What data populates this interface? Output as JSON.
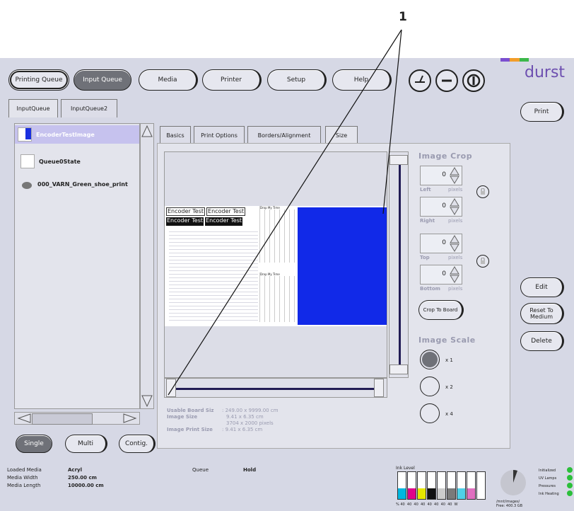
{
  "callout": {
    "number": "1"
  },
  "nav": {
    "printing_queue": "Printing Queue",
    "input_queue": "Input Queue",
    "media": "Media",
    "printer": "Printer",
    "setup": "Setup",
    "help": "Help"
  },
  "brand": {
    "name": "durst",
    "colors": [
      "#7b4fd0",
      "#f29d2a",
      "#3cb84a"
    ]
  },
  "queue_tabs": [
    "InputQueue",
    "InputQueue2"
  ],
  "queue_items": [
    {
      "name": "EncoderTestImage",
      "selected": true
    },
    {
      "name": "Queue0State",
      "selected": false
    },
    {
      "name": "000_VARN_Green_shoe_print",
      "selected": false
    }
  ],
  "queue_modes": {
    "single": "Single",
    "multi": "Multi",
    "contig": "Contig."
  },
  "detail_tabs": [
    "Basics",
    "Print Options",
    "Borders/Alignment",
    "Size"
  ],
  "preview": {
    "encoder_text": "Encoder Test",
    "chart_caption": "Drop My Time"
  },
  "image_crop": {
    "title": "Image Crop",
    "left": {
      "value": "0",
      "label": "Left",
      "unit": "pixels"
    },
    "right": {
      "value": "0",
      "label": "Right",
      "unit": "pixels"
    },
    "top": {
      "value": "0",
      "label": "Top",
      "unit": "pixels"
    },
    "bottom": {
      "value": "0",
      "label": "Bottom",
      "unit": "pixels"
    },
    "crop_button": "Crop To Board"
  },
  "image_scale": {
    "title": "Image Scale",
    "options": [
      "x 1",
      "x 2",
      "x 4"
    ],
    "selected": "x 1"
  },
  "info": {
    "usable_board_label": "Usable Board Siz",
    "usable_board_value": ": 249.00 x 9999.00 cm",
    "image_size_label": "Image Size",
    "image_size_value": "9.41 x 6.35 cm",
    "image_size_pixels": "3704 x 2000 pixels",
    "print_size_label": "Image Print Size",
    "print_size_value": ": 9.41 x 6.35 cm"
  },
  "right_buttons": {
    "print": "Print",
    "edit": "Edit",
    "reset": "Reset To Medium",
    "delete": "Delete"
  },
  "footer": {
    "loaded_media_label": "Loaded Media",
    "loaded_media_value": "Acryl",
    "media_width_label": "Media Width",
    "media_width_value": "250.00 cm",
    "media_length_label": "Media Length",
    "media_length_value": "10000.00 cm",
    "queue_label": "Queue",
    "queue_value": "Hold",
    "ink_level_label": "Ink Level",
    "ink_scale": "% 40  40  40  40  40  40  40  40  W",
    "disk_label": "/mnt/images/",
    "disk_free": "Free: 400.3 GB",
    "status": [
      "Initialized",
      "UV Lamps",
      "Pressures",
      "Ink Heating"
    ]
  },
  "ink_levels": [
    0.4,
    0.4,
    0.4,
    0.4,
    0.4,
    0.4,
    0.4,
    0.4,
    0.4
  ],
  "ink_colors": [
    "#00b7e0",
    "#e0008a",
    "#e6e600",
    "#111111",
    "#cccccc",
    "#7a7a7a",
    "#4fd0e8",
    "#e070c0",
    "#ffffff"
  ]
}
